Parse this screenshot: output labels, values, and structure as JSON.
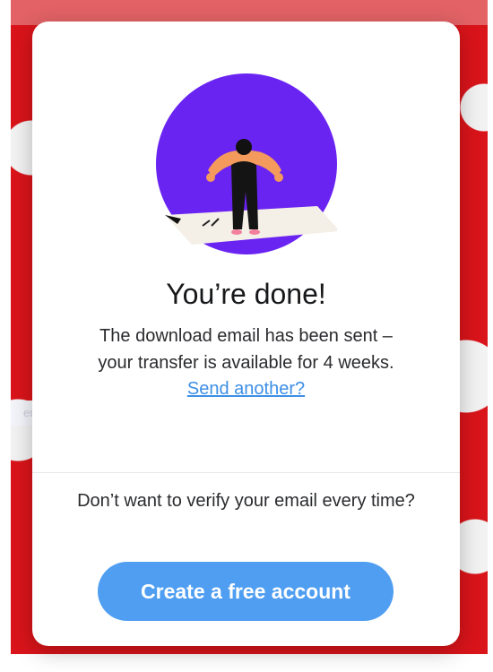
{
  "background": {
    "faint_input_text": "er Strip"
  },
  "dialog": {
    "title": "You’re done!",
    "message_line1": "The download email has been sent –",
    "message_line2": "your transfer is available for 4 weeks.",
    "send_another_link": "Send another?",
    "verify_prompt": "Don’t want to verify your email every time?",
    "cta_label": "Create a free account"
  },
  "colors": {
    "accent": "#4f9ef1",
    "link": "#3d8fe6",
    "illustration_circle": "#6a24f2",
    "background_red": "#d9141a"
  },
  "icons": {
    "illustration": "person-standing-on-paper-illustration"
  }
}
